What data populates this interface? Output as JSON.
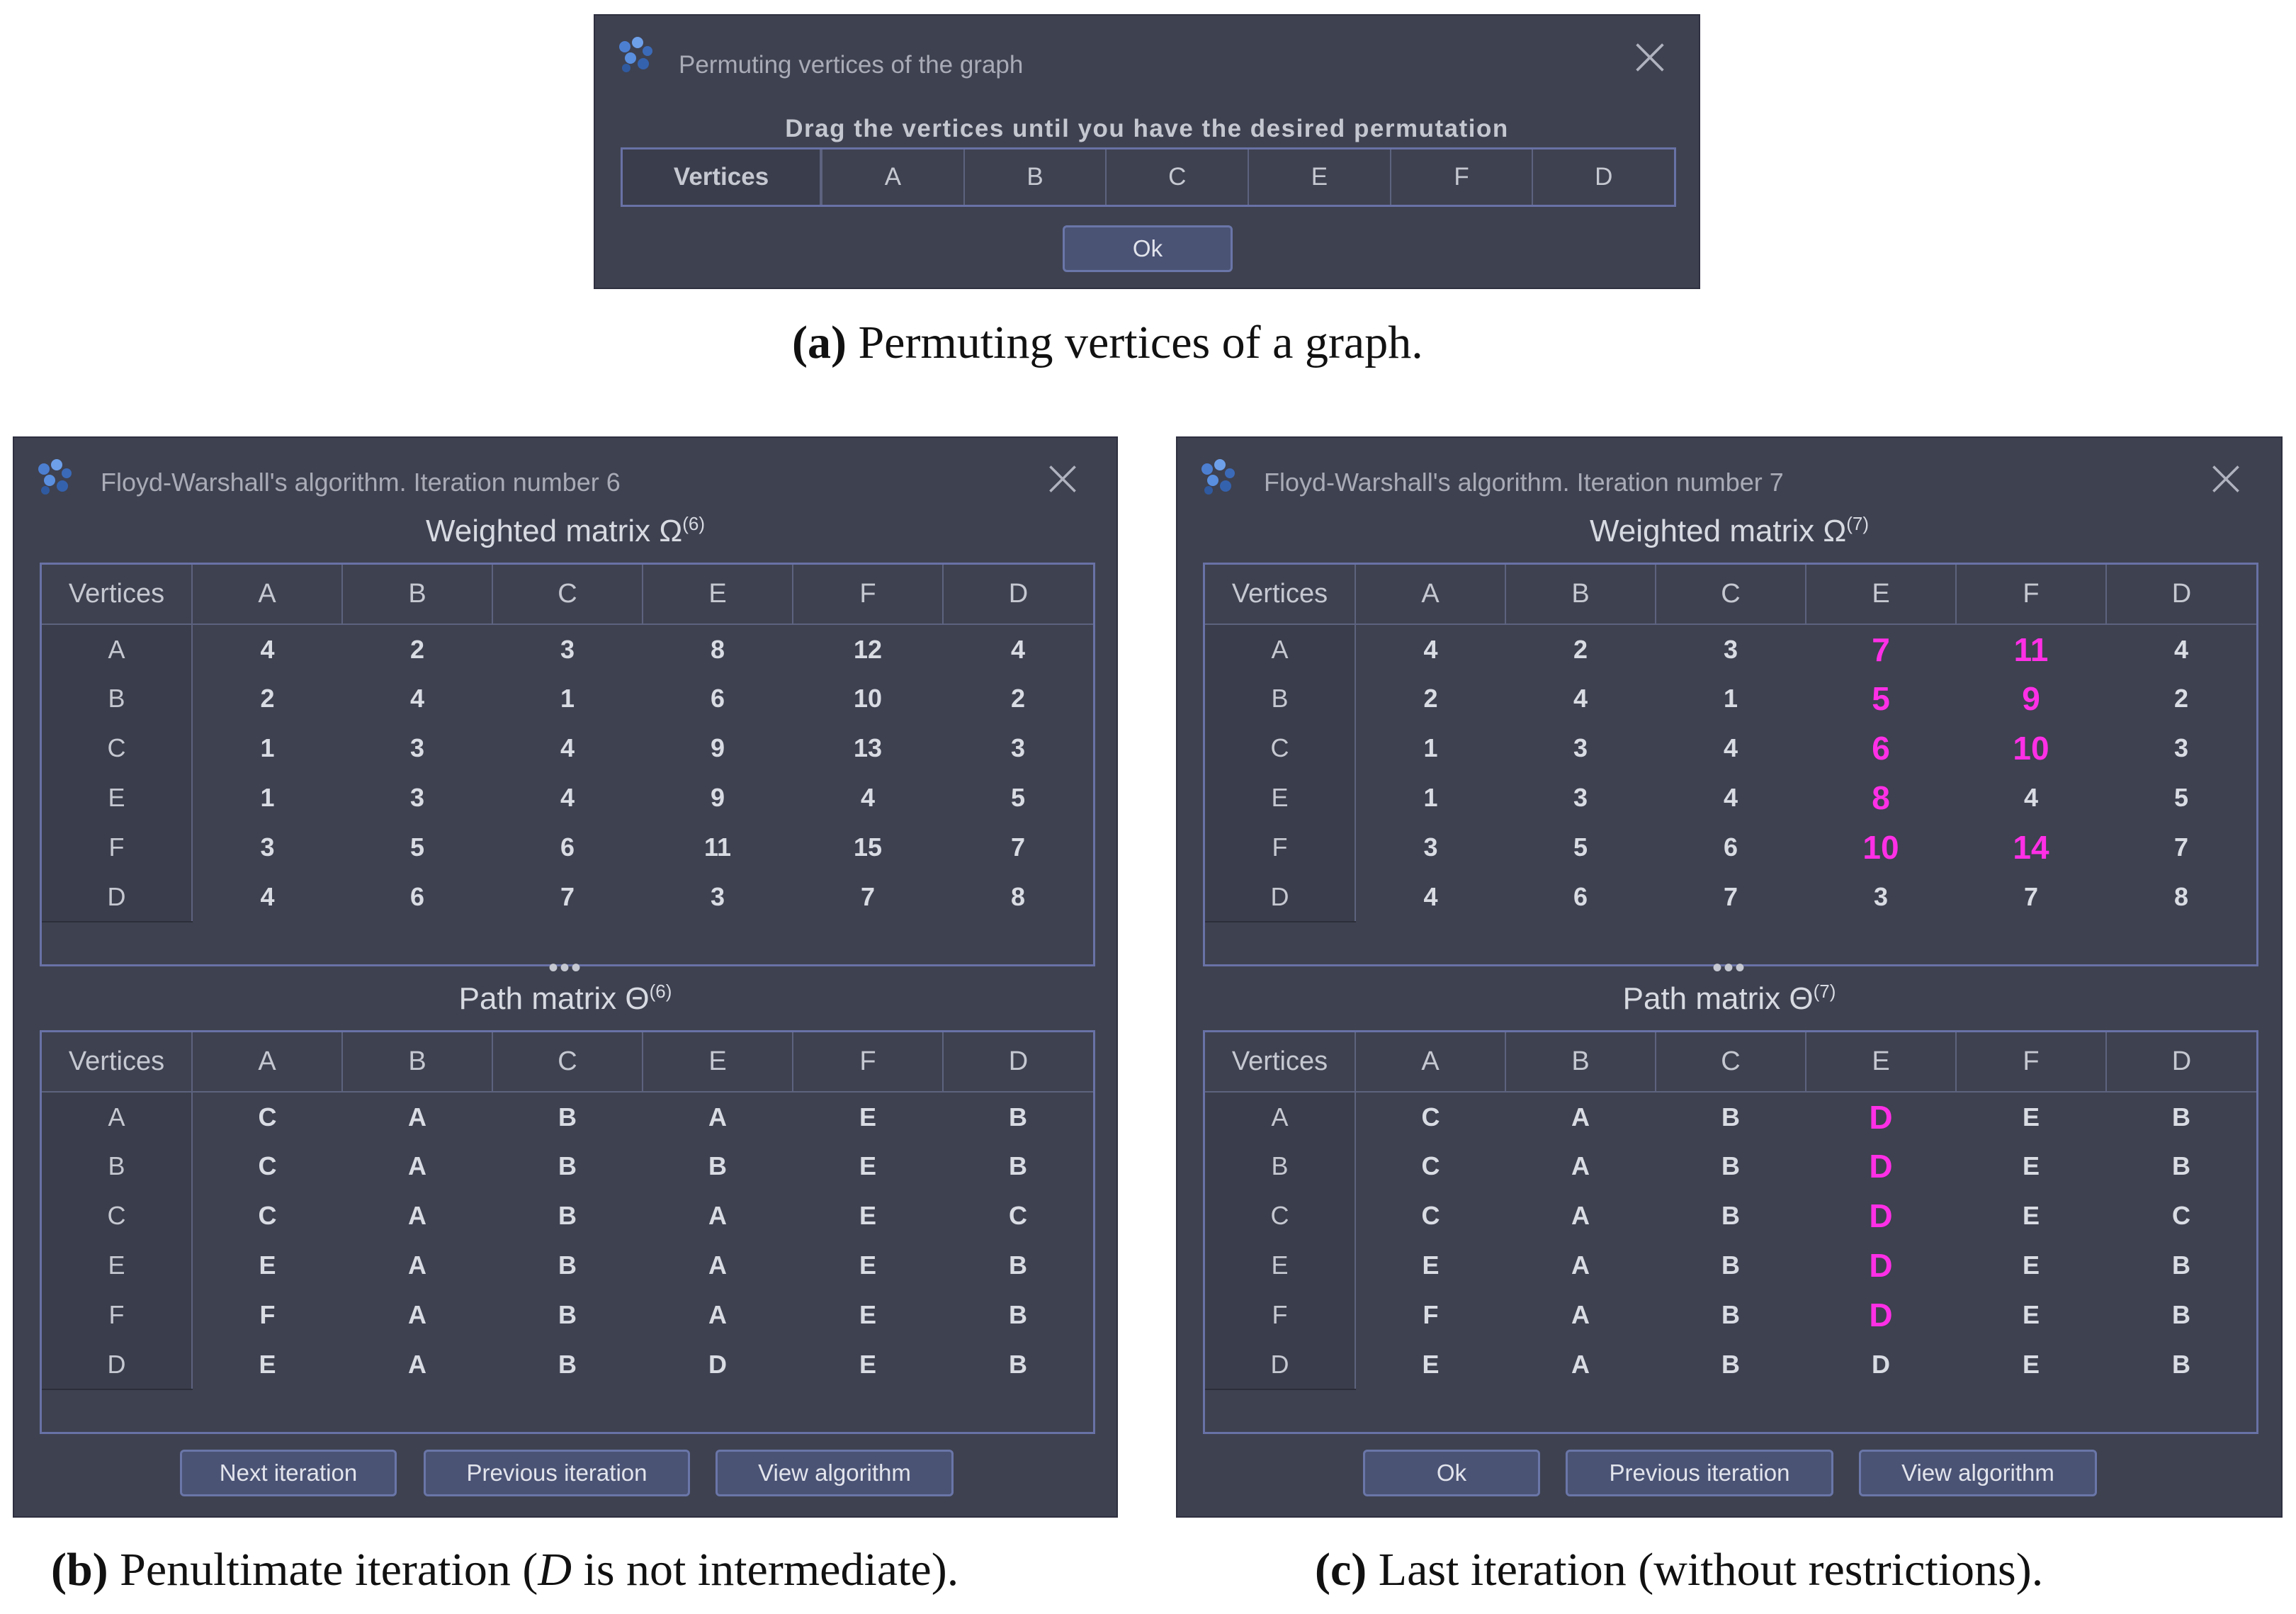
{
  "permute_window": {
    "title": "Permuting vertices of the graph",
    "instruction": "Drag the vertices until you have the desired permutation",
    "header": "Vertices",
    "vertices": [
      "A",
      "B",
      "C",
      "E",
      "F",
      "D"
    ],
    "ok_label": "Ok"
  },
  "caption_a": {
    "label": "(a)",
    "text": " Permuting vertices of a graph."
  },
  "iteration6": {
    "title": "Floyd-Warshall's algorithm. Iteration number 6",
    "weighted_title": "Weighted matrix Ω",
    "weighted_sup": "(6)",
    "path_title": "Path matrix Θ",
    "path_sup": "(6)",
    "dots": "•••",
    "columns": [
      "Vertices",
      "A",
      "B",
      "C",
      "E",
      "F",
      "D"
    ],
    "rows": [
      "A",
      "B",
      "C",
      "E",
      "F",
      "D"
    ],
    "weighted": [
      [
        "4",
        "2",
        "3",
        "8",
        "12",
        "4"
      ],
      [
        "2",
        "4",
        "1",
        "6",
        "10",
        "2"
      ],
      [
        "1",
        "3",
        "4",
        "9",
        "13",
        "3"
      ],
      [
        "1",
        "3",
        "4",
        "9",
        "4",
        "5"
      ],
      [
        "3",
        "5",
        "6",
        "11",
        "15",
        "7"
      ],
      [
        "4",
        "6",
        "7",
        "3",
        "7",
        "8"
      ]
    ],
    "path": [
      [
        "C",
        "A",
        "B",
        "A",
        "E",
        "B"
      ],
      [
        "C",
        "A",
        "B",
        "B",
        "E",
        "B"
      ],
      [
        "C",
        "A",
        "B",
        "A",
        "E",
        "C"
      ],
      [
        "E",
        "A",
        "B",
        "A",
        "E",
        "B"
      ],
      [
        "F",
        "A",
        "B",
        "A",
        "E",
        "B"
      ],
      [
        "E",
        "A",
        "B",
        "D",
        "E",
        "B"
      ]
    ],
    "buttons": [
      "Next iteration",
      "Previous iteration",
      "View algorithm"
    ]
  },
  "caption_b": {
    "label": "(b)",
    "text_before": " Penultimate iteration (",
    "italic": "D",
    "text_after": " is not intermediate)."
  },
  "iteration7": {
    "title": "Floyd-Warshall's algorithm. Iteration number 7",
    "weighted_title": "Weighted matrix Ω",
    "weighted_sup": "(7)",
    "path_title": "Path matrix Θ",
    "path_sup": "(7)",
    "dots": "•••",
    "columns": [
      "Vertices",
      "A",
      "B",
      "C",
      "E",
      "F",
      "D"
    ],
    "rows": [
      "A",
      "B",
      "C",
      "E",
      "F",
      "D"
    ],
    "weighted": [
      [
        "4",
        "2",
        "3",
        "7",
        "11",
        "4"
      ],
      [
        "2",
        "4",
        "1",
        "5",
        "9",
        "2"
      ],
      [
        "1",
        "3",
        "4",
        "6",
        "10",
        "3"
      ],
      [
        "1",
        "3",
        "4",
        "8",
        "4",
        "5"
      ],
      [
        "3",
        "5",
        "6",
        "10",
        "14",
        "7"
      ],
      [
        "4",
        "6",
        "7",
        "3",
        "7",
        "8"
      ]
    ],
    "weighted_changed": [
      [
        false,
        false,
        false,
        true,
        true,
        false
      ],
      [
        false,
        false,
        false,
        true,
        true,
        false
      ],
      [
        false,
        false,
        false,
        true,
        true,
        false
      ],
      [
        false,
        false,
        false,
        true,
        false,
        false
      ],
      [
        false,
        false,
        false,
        true,
        true,
        false
      ],
      [
        false,
        false,
        false,
        false,
        false,
        false
      ]
    ],
    "path": [
      [
        "C",
        "A",
        "B",
        "D",
        "E",
        "B"
      ],
      [
        "C",
        "A",
        "B",
        "D",
        "E",
        "B"
      ],
      [
        "C",
        "A",
        "B",
        "D",
        "E",
        "C"
      ],
      [
        "E",
        "A",
        "B",
        "D",
        "E",
        "B"
      ],
      [
        "F",
        "A",
        "B",
        "D",
        "E",
        "B"
      ],
      [
        "E",
        "A",
        "B",
        "D",
        "E",
        "B"
      ]
    ],
    "path_changed": [
      [
        false,
        false,
        false,
        true,
        false,
        false
      ],
      [
        false,
        false,
        false,
        true,
        false,
        false
      ],
      [
        false,
        false,
        false,
        true,
        false,
        false
      ],
      [
        false,
        false,
        false,
        true,
        false,
        false
      ],
      [
        false,
        false,
        false,
        true,
        false,
        false
      ],
      [
        false,
        false,
        false,
        false,
        false,
        false
      ]
    ],
    "buttons": [
      "Ok",
      "Previous iteration",
      "View algorithm"
    ]
  },
  "caption_c": {
    "label": "(c)",
    "text": " Last iteration (without restrictions)."
  },
  "colors": {
    "window_bg": "#3e4150",
    "border_accent": "#6972a6",
    "highlight": "#ff2fe6"
  },
  "icons": [
    "app-cube-icon",
    "close-icon"
  ]
}
